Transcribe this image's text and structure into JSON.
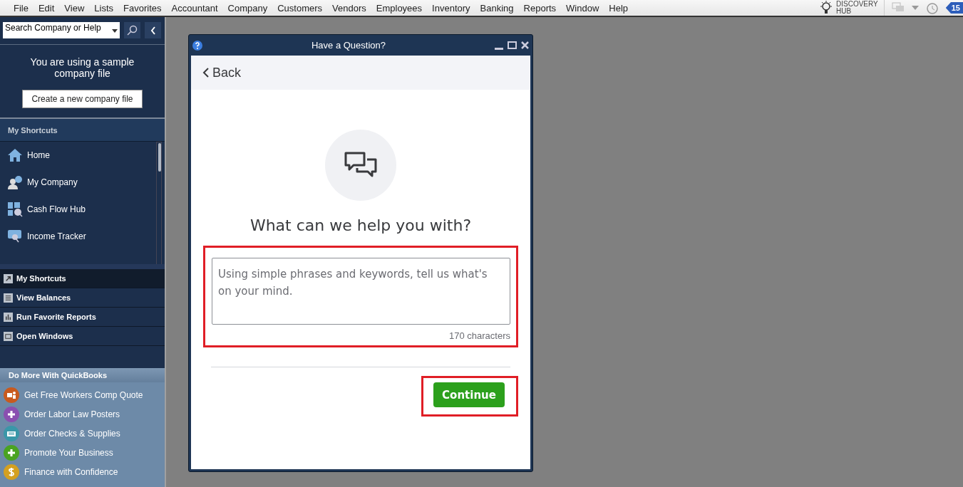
{
  "menu_bar": {
    "items": [
      "File",
      "Edit",
      "View",
      "Lists",
      "Favorites",
      "Accountant",
      "Company",
      "Customers",
      "Vendors",
      "Employees",
      "Inventory",
      "Banking",
      "Reports",
      "Window",
      "Help"
    ],
    "discovery_hub": {
      "line_1": "DISCOVERY",
      "line_2": "HUB"
    },
    "reminder_count": "15"
  },
  "sidebar": {
    "search": {
      "placeholder": "Search Company or Help"
    },
    "sample_notice": "You are using a sample company file",
    "create_button": "Create a new company file",
    "shortcuts_title": "My Shortcuts",
    "shortcuts": [
      {
        "label": "Home",
        "kind": "home"
      },
      {
        "label": "My Company",
        "kind": "company"
      },
      {
        "label": "Cash Flow Hub",
        "kind": "cashflow"
      },
      {
        "label": "Income Tracker",
        "kind": "tracker"
      }
    ],
    "nav_tabs": [
      {
        "label": "My Shortcuts",
        "selected": true,
        "kind": "shortcuts"
      },
      {
        "label": "View Balances",
        "selected": false,
        "kind": "balances"
      },
      {
        "label": "Run Favorite Reports",
        "selected": false,
        "kind": "reports"
      },
      {
        "label": "Open Windows",
        "selected": false,
        "kind": "windows"
      }
    ],
    "more_title": "Do More With QuickBooks",
    "more_items": [
      {
        "label": "Get Free Workers Comp Quote",
        "color": "#c85a1e",
        "kind": "people"
      },
      {
        "label": "Order Labor Law Posters",
        "color": "#8a4fb0",
        "kind": "plus"
      },
      {
        "label": "Order Checks & Supplies",
        "color": "#3a97a8",
        "kind": "printer"
      },
      {
        "label": "Promote Your Business",
        "color": "#4aa321",
        "kind": "plus"
      },
      {
        "label": "Finance with Confidence",
        "color": "#d4a020",
        "kind": "dollar"
      }
    ]
  },
  "dialog": {
    "title": "Have a Question?",
    "back": "Back",
    "heading": "What can we help you with?",
    "question": {
      "placeholder": "Using simple phrases and keywords, tell us what's on your mind.",
      "counter": "170 characters",
      "highlighted": true
    },
    "continue": {
      "label": "Continue",
      "highlighted": true
    }
  }
}
